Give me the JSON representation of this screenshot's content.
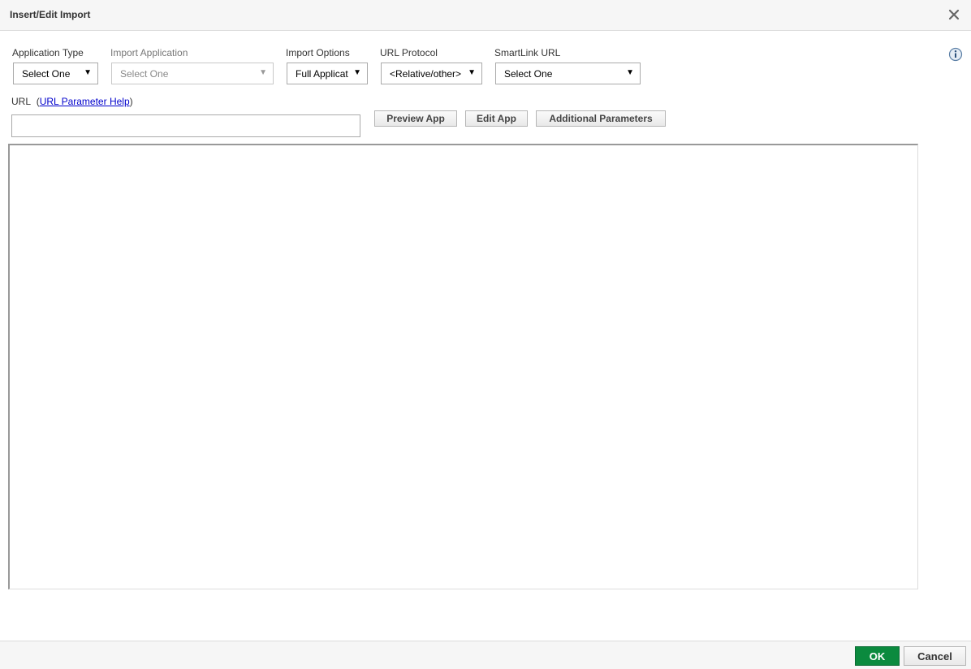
{
  "dialog": {
    "title": "Insert/Edit Import",
    "close_icon": "close-icon",
    "info_icon": "info-icon"
  },
  "fields": {
    "application_type": {
      "label": "Application Type",
      "value": "Select One"
    },
    "import_application": {
      "label": "Import Application",
      "value": "Select One"
    },
    "import_options": {
      "label": "Import Options",
      "value": "Full Applicat"
    },
    "url_protocol": {
      "label": "URL Protocol",
      "value": "<Relative/other>"
    },
    "smartlink_url": {
      "label": "SmartLink URL",
      "value": "Select One"
    }
  },
  "url": {
    "label": "URL",
    "open_paren": "(",
    "help_link": "URL Parameter Help",
    "close_paren": ")",
    "value": "",
    "placeholder": ""
  },
  "buttons": {
    "preview_app": "Preview App",
    "edit_app": "Edit App",
    "additional_parameters": "Additional Parameters"
  },
  "footer": {
    "ok": "OK",
    "cancel": "Cancel"
  },
  "colors": {
    "ok_background": "#0b8a3e",
    "link": "#0000cc",
    "titlebar_background": "#f6f6f6"
  }
}
